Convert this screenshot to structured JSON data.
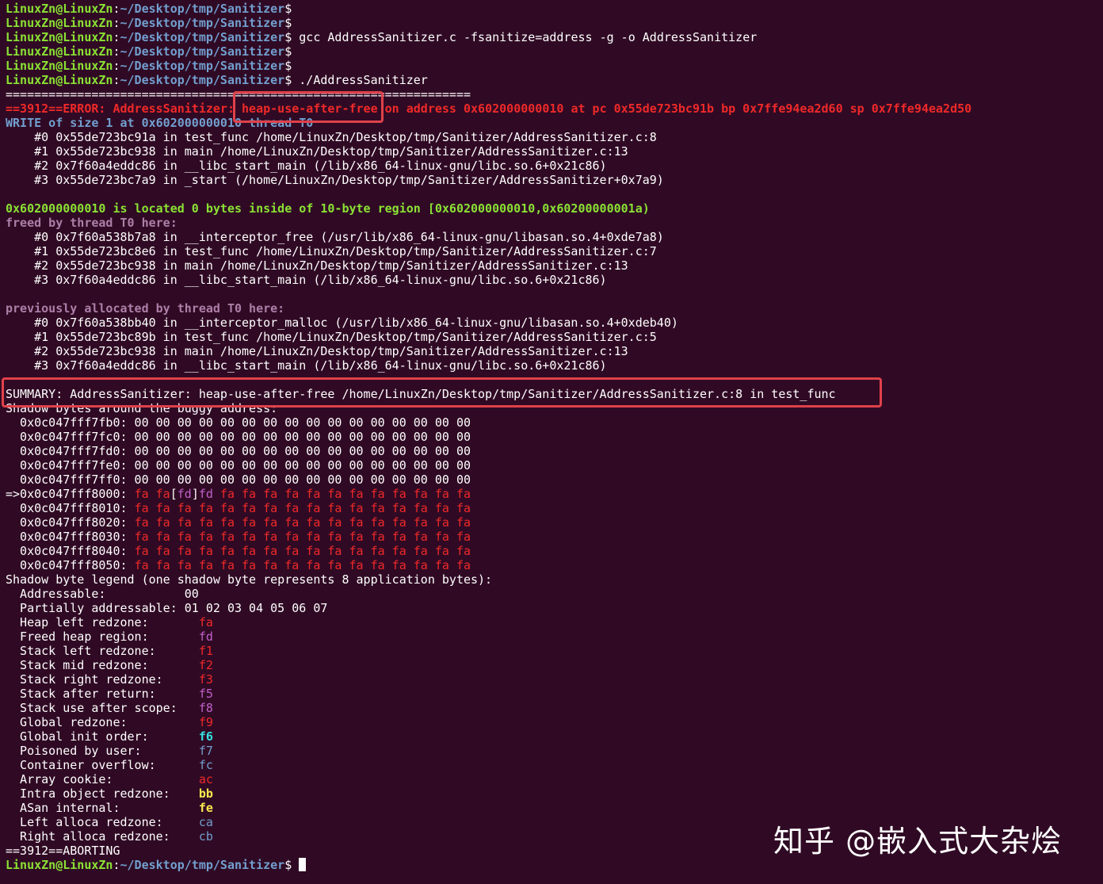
{
  "prompt": {
    "user_host": "LinuxZn@LinuxZn",
    "sep": ":",
    "path": "~/Desktop/tmp/Sanitizer",
    "dollar": "$"
  },
  "commands": {
    "compile": " gcc AddressSanitizer.c -fsanitize=address -g -o AddressSanitizer",
    "run": " ./AddressSanitizer"
  },
  "report": {
    "separator": "=================================================================",
    "error_prefix": "==3912==ERROR: AddressSanitizer: ",
    "error_type": "heap-use-after-free",
    "error_suffix": " on address 0x602000000010 at pc 0x55de723bc91b bp 0x7ffe94ea2d60 sp 0x7ffe94ea2d50",
    "write_line": "WRITE of size 1 at 0x602000000010 thread T0",
    "write_stack": [
      "    #0 0x55de723bc91a in test_func /home/LinuxZn/Desktop/tmp/Sanitizer/AddressSanitizer.c:8",
      "    #1 0x55de723bc938 in main /home/LinuxZn/Desktop/tmp/Sanitizer/AddressSanitizer.c:13",
      "    #2 0x7f60a4eddc86 in __libc_start_main (/lib/x86_64-linux-gnu/libc.so.6+0x21c86)",
      "    #3 0x55de723bc7a9 in _start (/home/LinuxZn/Desktop/tmp/Sanitizer/AddressSanitizer+0x7a9)"
    ],
    "located_line": "0x602000000010 is located 0 bytes inside of 10-byte region [0x602000000010,0x60200000001a)",
    "freed_line": "freed by thread T0 here:",
    "freed_stack": [
      "    #0 0x7f60a538b7a8 in __interceptor_free (/usr/lib/x86_64-linux-gnu/libasan.so.4+0xde7a8)",
      "    #1 0x55de723bc8e6 in test_func /home/LinuxZn/Desktop/tmp/Sanitizer/AddressSanitizer.c:7",
      "    #2 0x55de723bc938 in main /home/LinuxZn/Desktop/tmp/Sanitizer/AddressSanitizer.c:13",
      "    #3 0x7f60a4eddc86 in __libc_start_main (/lib/x86_64-linux-gnu/libc.so.6+0x21c86)"
    ],
    "alloc_line": "previously allocated by thread T0 here:",
    "alloc_stack": [
      "    #0 0x7f60a538bb40 in __interceptor_malloc (/usr/lib/x86_64-linux-gnu/libasan.so.4+0xdeb40)",
      "    #1 0x55de723bc89b in test_func /home/LinuxZn/Desktop/tmp/Sanitizer/AddressSanitizer.c:5",
      "    #2 0x55de723bc938 in main /home/LinuxZn/Desktop/tmp/Sanitizer/AddressSanitizer.c:13",
      "    #3 0x7f60a4eddc86 in __libc_start_main (/lib/x86_64-linux-gnu/libc.so.6+0x21c86)"
    ],
    "summary_line": "SUMMARY: AddressSanitizer: heap-use-after-free /home/LinuxZn/Desktop/tmp/Sanitizer/AddressSanitizer.c:8 in test_func",
    "shadow_header": "Shadow bytes around the buggy address:",
    "shadow_zero_rows": [
      "  0x0c047fff7fb0: 00 00 00 00 00 00 00 00 00 00 00 00 00 00 00 00",
      "  0x0c047fff7fc0: 00 00 00 00 00 00 00 00 00 00 00 00 00 00 00 00",
      "  0x0c047fff7fd0: 00 00 00 00 00 00 00 00 00 00 00 00 00 00 00 00",
      "  0x0c047fff7fe0: 00 00 00 00 00 00 00 00 00 00 00 00 00 00 00 00",
      "  0x0c047fff7ff0: 00 00 00 00 00 00 00 00 00 00 00 00 00 00 00 00"
    ],
    "shadow_marked_row": {
      "prefix": "=>0x0c047fff8000: ",
      "fa1": "fa",
      "fa2": " fa",
      "lb": "[",
      "fd1": "fd",
      "rb": "]",
      "fd2": "fd",
      "rest": " fa fa fa fa fa fa fa fa fa fa fa fa"
    },
    "shadow_fa_rows": [
      {
        "addr": "  0x0c047fff8010: ",
        "bytes": "fa fa fa fa fa fa fa fa fa fa fa fa fa fa fa fa"
      },
      {
        "addr": "  0x0c047fff8020: ",
        "bytes": "fa fa fa fa fa fa fa fa fa fa fa fa fa fa fa fa"
      },
      {
        "addr": "  0x0c047fff8030: ",
        "bytes": "fa fa fa fa fa fa fa fa fa fa fa fa fa fa fa fa"
      },
      {
        "addr": "  0x0c047fff8040: ",
        "bytes": "fa fa fa fa fa fa fa fa fa fa fa fa fa fa fa fa"
      },
      {
        "addr": "  0x0c047fff8050: ",
        "bytes": "fa fa fa fa fa fa fa fa fa fa fa fa fa fa fa fa"
      }
    ],
    "legend_header": "Shadow byte legend (one shadow byte represents 8 application bytes):",
    "legend": {
      "addressable": {
        "label": "  Addressable:           ",
        "value": "00"
      },
      "partial": {
        "label": "  Partially addressable: ",
        "value": "01 02 03 04 05 06 07"
      },
      "items": [
        {
          "label": "  Heap left redzone:       ",
          "value": "fa",
          "cls": "r"
        },
        {
          "label": "  Freed heap region:       ",
          "value": "fd",
          "cls": "pk"
        },
        {
          "label": "  Stack left redzone:      ",
          "value": "f1",
          "cls": "r"
        },
        {
          "label": "  Stack mid redzone:       ",
          "value": "f2",
          "cls": "r"
        },
        {
          "label": "  Stack right redzone:     ",
          "value": "f3",
          "cls": "r"
        },
        {
          "label": "  Stack after return:      ",
          "value": "f5",
          "cls": "pk"
        },
        {
          "label": "  Stack use after scope:   ",
          "value": "f8",
          "cls": "pk"
        },
        {
          "label": "  Global redzone:          ",
          "value": "f9",
          "cls": "r"
        },
        {
          "label": "  Global init order:       ",
          "value": "f6",
          "cls": "c"
        },
        {
          "label": "  Poisoned by user:        ",
          "value": "f7",
          "cls": "bl"
        },
        {
          "label": "  Container overflow:      ",
          "value": "fc",
          "cls": "bl"
        },
        {
          "label": "  Array cookie:            ",
          "value": "ac",
          "cls": "r"
        },
        {
          "label": "  Intra object redzone:    ",
          "value": "bb",
          "cls": "y"
        },
        {
          "label": "  ASan internal:           ",
          "value": "fe",
          "cls": "y"
        },
        {
          "label": "  Left alloca redzone:     ",
          "value": "ca",
          "cls": "bl"
        },
        {
          "label": "  Right alloca redzone:    ",
          "value": "cb",
          "cls": "bl"
        }
      ]
    },
    "aborting": "==3912==ABORTING"
  },
  "watermark": "知乎 @嵌入式大杂烩",
  "colors": {
    "background": "#300a24",
    "prompt_user": "#8ae234",
    "prompt_path": "#729fcf",
    "error": "#ef2929",
    "highlight_box": "#e0414a"
  }
}
